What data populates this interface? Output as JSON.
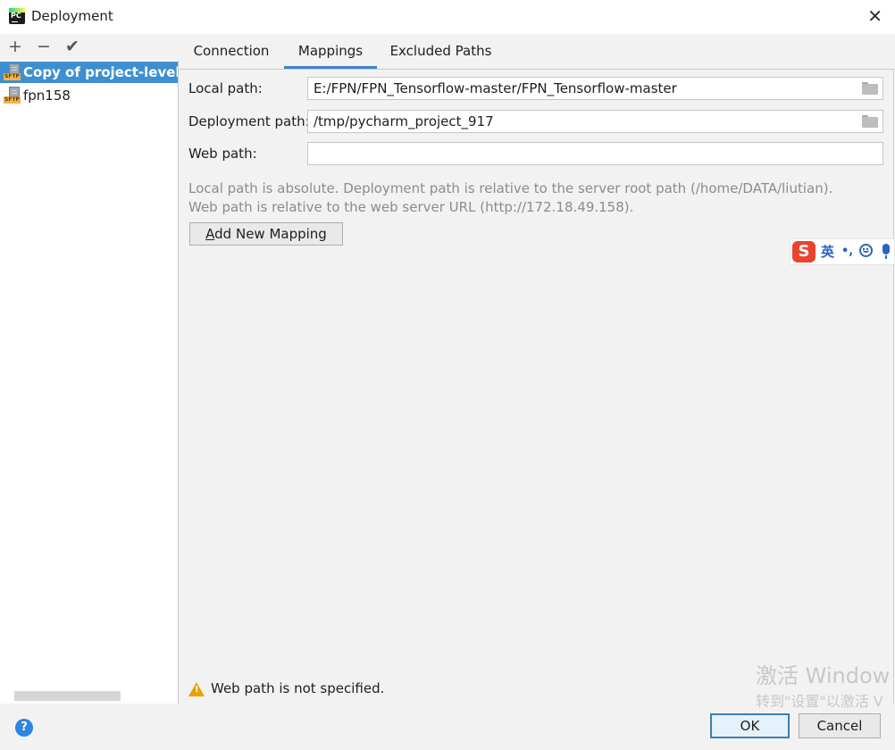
{
  "window": {
    "app_icon_text": "PC",
    "title": "Deployment",
    "close_glyph": "✕",
    "close_icon": "close-icon"
  },
  "left_panel": {
    "toolbar": {
      "add_glyph": "+",
      "remove_glyph": "−",
      "check_glyph": "✔",
      "add_icon": "plus-icon",
      "remove_icon": "minus-icon",
      "check_icon": "check-icon"
    },
    "servers": [
      {
        "label": "Copy of project-level se",
        "icon": "sftp-server-icon",
        "icon_text": "SFTP",
        "selected": true
      },
      {
        "label": "fpn158",
        "icon": "sftp-server-icon",
        "icon_text": "SFTP",
        "selected": false
      }
    ]
  },
  "tabs": [
    {
      "label": "Connection",
      "active": false
    },
    {
      "label": "Mappings",
      "active": true
    },
    {
      "label": "Excluded Paths",
      "active": false
    }
  ],
  "mappings": {
    "local_path": {
      "label": "Local path:",
      "value": "E:/FPN/FPN_Tensorflow-master/FPN_Tensorflow-master",
      "icon": "folder-icon"
    },
    "deployment_path": {
      "label": "Deployment path:",
      "value": "/tmp/pycharm_project_917",
      "icon": "folder-icon"
    },
    "web_path": {
      "label": "Web path:",
      "value": ""
    },
    "help_line_1": "Local path is absolute. Deployment path is relative to the server root path (/home/DATA/liutian).",
    "help_line_2": "Web path is relative to the web server URL (http://172.18.49.158).",
    "add_button": {
      "mnemonic": "A",
      "rest": "dd New Mapping"
    },
    "warning": {
      "icon": "warning-icon",
      "text": "Web path is not specified.",
      "color": "#e9a100"
    }
  },
  "footer": {
    "help_glyph": "?",
    "help_icon": "help-icon",
    "ok_label": "OK",
    "cancel_label": "Cancel"
  },
  "ime_toolbar": {
    "logo_glyph": "S",
    "language": "英",
    "punctuation_glyph": "•,",
    "emoji_icon": "smiley-icon",
    "voice_icon": "microphone-icon"
  },
  "watermark": {
    "line_1": "激活 Window",
    "line_2": "转到\"设置\"以激活 V"
  },
  "colors": {
    "accent": "#3d8fd1",
    "tab_underline": "#4083c9",
    "ok_border": "#3c7fb1",
    "help_blue": "#2e86de",
    "ime_red": "#e8432d"
  }
}
